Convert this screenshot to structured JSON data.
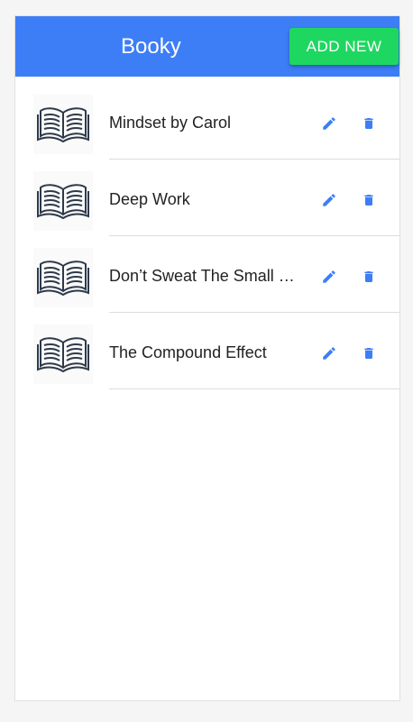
{
  "app": {
    "title": "Booky",
    "add_button": "ADD NEW"
  },
  "colors": {
    "appbar": "#3d7ef7",
    "add_button": "#1ed760",
    "action_icon": "#3d7ef7",
    "book_icon": "#2e3a4a"
  },
  "books": [
    {
      "title": "Mindset by Carol"
    },
    {
      "title": "Deep Work"
    },
    {
      "title": "Don’t Sweat The Small Stuff"
    },
    {
      "title": "The Compound Effect"
    }
  ],
  "icons": {
    "thumbnail": "open-book-icon",
    "edit": "pencil-icon",
    "delete": "trash-icon"
  }
}
